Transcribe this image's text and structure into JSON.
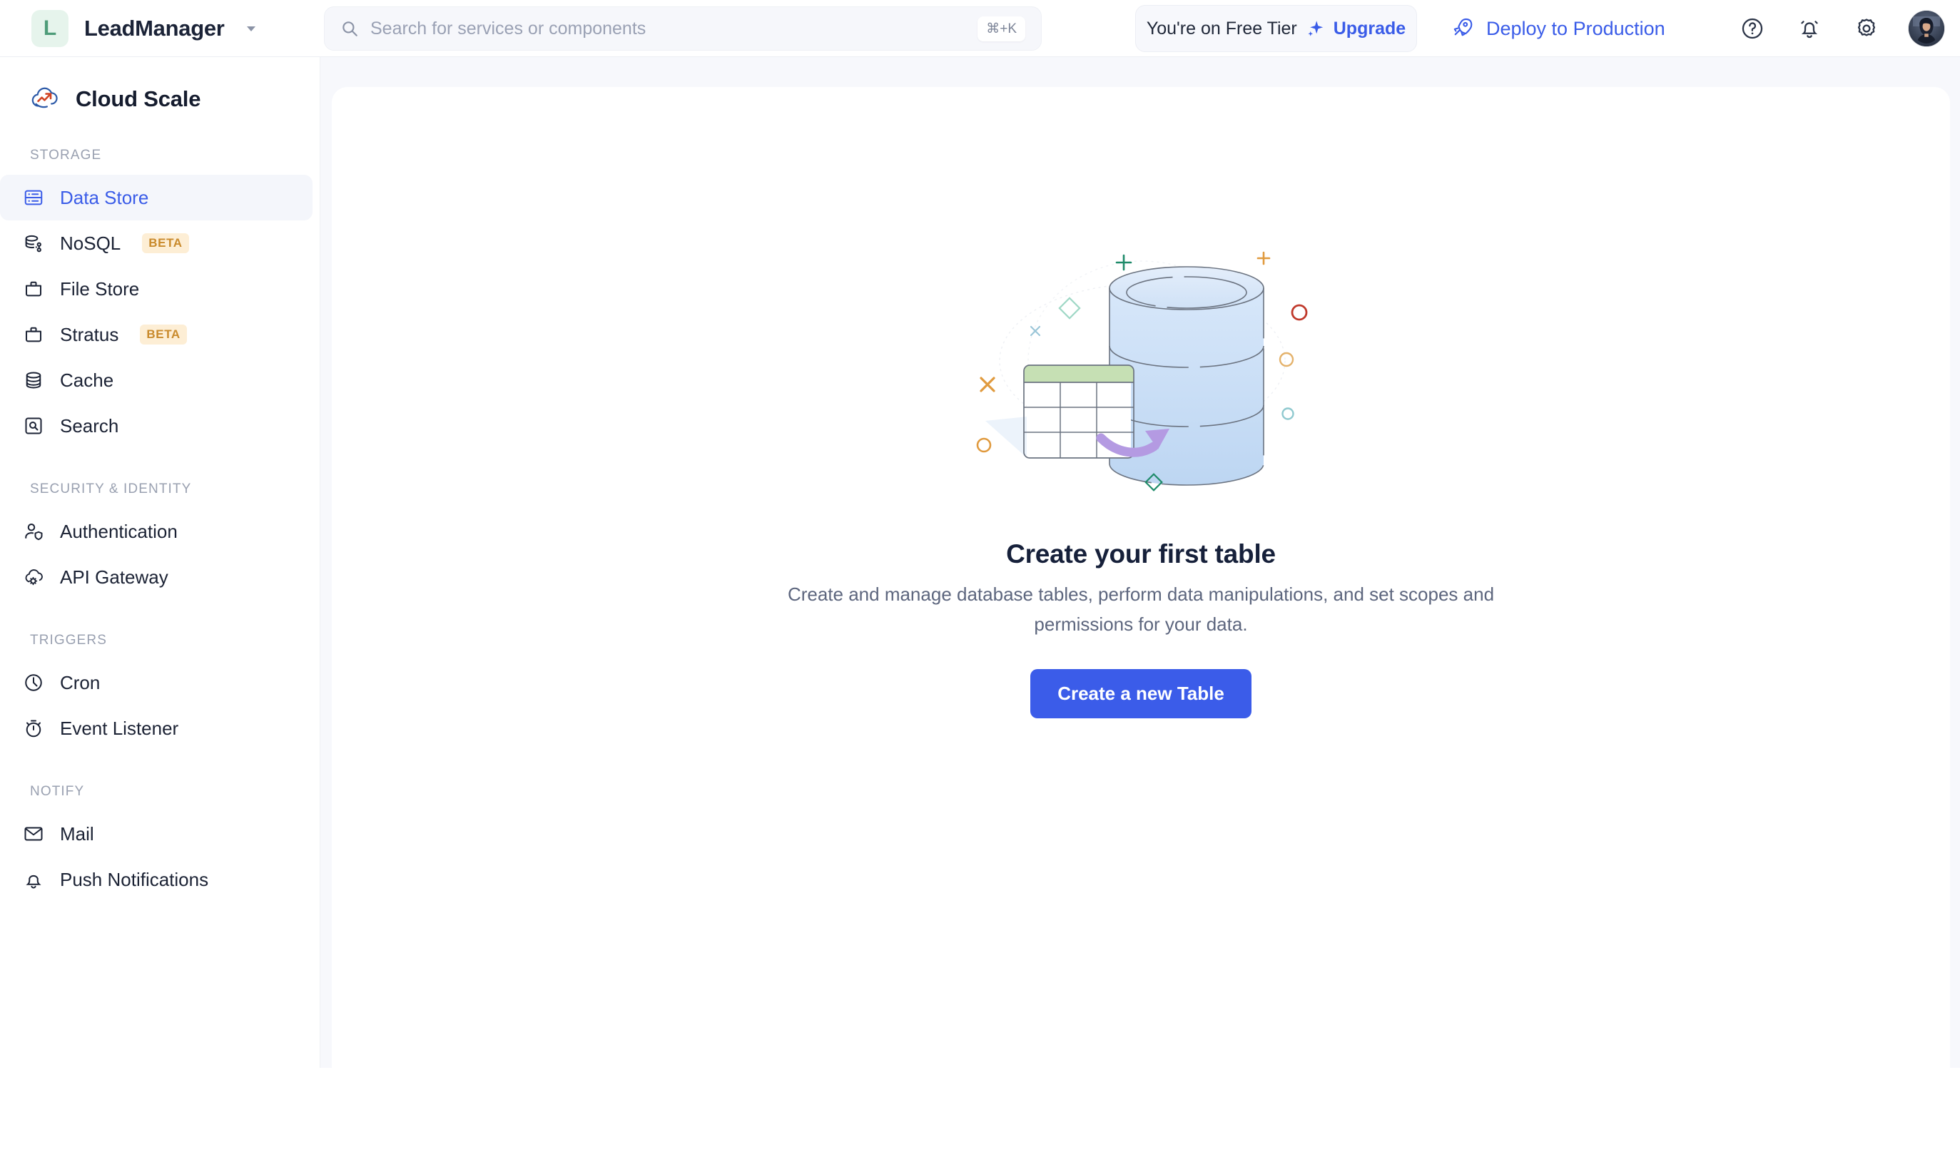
{
  "topbar": {
    "org_initial": "L",
    "org_name": "LeadManager",
    "org_caret_icon": "chevron-down-icon",
    "search": {
      "icon": "search-icon",
      "placeholder": "Search for services or components",
      "value": "",
      "shortcut": "⌘+K"
    },
    "tier": {
      "text": "You're on Free Tier",
      "sparkle_icon": "sparkles-icon",
      "upgrade_label": "Upgrade"
    },
    "deploy": {
      "icon": "rocket-icon",
      "label": "Deploy to Production"
    },
    "icons": [
      {
        "name": "help-icon",
        "glyph": "?"
      },
      {
        "name": "notification-bell-icon",
        "glyph": "bell"
      },
      {
        "name": "settings-gear-icon",
        "glyph": "gear"
      }
    ],
    "avatar_name": "user-avatar"
  },
  "sidebar": {
    "product": {
      "logo_icon": "cloud-scale-logo",
      "name": "Cloud Scale"
    },
    "sections": [
      {
        "heading": "STORAGE",
        "items": [
          {
            "label": "Data Store",
            "icon": "database-rows-icon",
            "active": true,
            "badge": ""
          },
          {
            "label": "NoSQL",
            "icon": "nosql-database-icon",
            "active": false,
            "badge": "BETA"
          },
          {
            "label": "File Store",
            "icon": "archive-box-icon",
            "active": false,
            "badge": ""
          },
          {
            "label": "Stratus",
            "icon": "archive-box-icon",
            "active": false,
            "badge": "BETA"
          },
          {
            "label": "Cache",
            "icon": "database-stack-icon",
            "active": false,
            "badge": ""
          },
          {
            "label": "Search",
            "icon": "search-box-icon",
            "active": false,
            "badge": ""
          }
        ]
      },
      {
        "heading": "SECURITY & IDENTITY",
        "items": [
          {
            "label": "Authentication",
            "icon": "user-shield-icon",
            "active": false,
            "badge": ""
          },
          {
            "label": "API Gateway",
            "icon": "cloud-gear-icon",
            "active": false,
            "badge": ""
          }
        ]
      },
      {
        "heading": "TRIGGERS",
        "items": [
          {
            "label": "Cron",
            "icon": "clock-icon",
            "active": false,
            "badge": ""
          },
          {
            "label": "Event Listener",
            "icon": "stopwatch-icon",
            "active": false,
            "badge": ""
          }
        ]
      },
      {
        "heading": "NOTIFY",
        "items": [
          {
            "label": "Mail",
            "icon": "envelope-icon",
            "active": false,
            "badge": ""
          },
          {
            "label": "Push Notifications",
            "icon": "bell-icon",
            "active": false,
            "badge": ""
          }
        ]
      }
    ]
  },
  "main": {
    "empty_state": {
      "illustration": "database-table-illustration",
      "title": "Create your first table",
      "description": "Create and manage database tables, perform data manipulations, and set scopes and permissions for your data.",
      "cta_label": "Create a new Table"
    }
  },
  "colors": {
    "accent_blue": "#3b5ce9",
    "brand_green": "#4e9c79",
    "beta_badge_bg": "#fdeed5",
    "beta_badge_text": "#c98a2c",
    "active_nav_bg": "#f4f6fb",
    "canvas_bg": "#f7f8fc",
    "heading_text": "#16203a",
    "body_text": "#5d667e"
  }
}
